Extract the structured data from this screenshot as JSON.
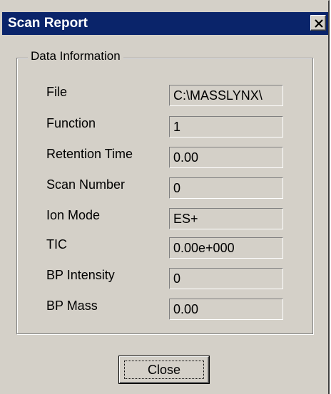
{
  "window": {
    "title": "Scan Report"
  },
  "group": {
    "legend": "Data Information"
  },
  "fields": [
    {
      "label": "File",
      "value": "C:\\MASSLYNX\\"
    },
    {
      "label": "Function",
      "value": "1"
    },
    {
      "label": "Retention Time",
      "value": "0.00"
    },
    {
      "label": "Scan Number",
      "value": "0"
    },
    {
      "label": "Ion Mode",
      "value": "ES+"
    },
    {
      "label": "TIC",
      "value": "0.00e+000"
    },
    {
      "label": "BP Intensity",
      "value": "0"
    },
    {
      "label": "BP Mass",
      "value": "0.00"
    }
  ],
  "buttons": {
    "close_label": "Close"
  },
  "icons": {
    "title_close": "close-icon"
  },
  "colors": {
    "titlebar": "#0a246a",
    "dialog_face": "#d4d0c8"
  }
}
